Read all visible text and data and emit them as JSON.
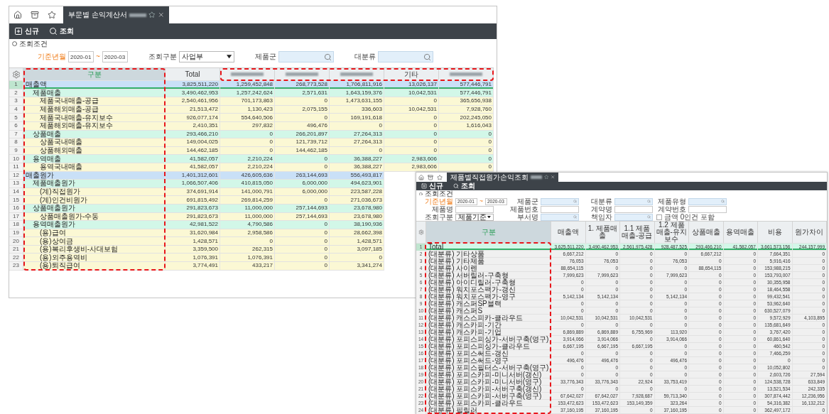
{
  "windows": [
    {
      "tab": {
        "title": "부문별 손익계산서",
        "title_redacted": true
      },
      "toolbar": [
        {
          "kind": "new",
          "label": "신규"
        },
        {
          "kind": "search",
          "label": "조회"
        }
      ],
      "filter_title": "조회조건",
      "filter_rows": [
        [
          {
            "kind": "period",
            "label": "기준년월",
            "required": true,
            "from": "2020-01",
            "separator": "~",
            "to": "2020-03"
          },
          {
            "kind": "select",
            "label": "조회구분",
            "required": false,
            "value": "사업부"
          },
          {
            "kind": "search",
            "label": "제품군",
            "required": false
          },
          {
            "kind": "search",
            "label": "대분류",
            "required": false
          }
        ]
      ],
      "grid": {
        "label_header": "구분",
        "columns": [
          {
            "label": "Total",
            "redacted": false
          },
          {
            "redacted": true
          },
          {
            "redacted": true
          },
          {
            "redacted": true
          },
          {
            "label": "기타",
            "redacted": false
          },
          {
            "redacted": true
          }
        ],
        "rows": [
          {
            "no": "1",
            "label": "매출액",
            "selected": true,
            "values": [
              "3,825,511,220",
              "1,259,452,848",
              "268,773,528",
              "1,706,811,916",
              "13,026,137",
              "577,446,791"
            ],
            "children": [
              {
                "no": "2",
                "label": "제품매출",
                "selected": false,
                "values": [
                  "3,490,462,953",
                  "1,257,242,624",
                  "2,571,631",
                  "1,643,159,376",
                  "10,042,531",
                  "577,446,791"
                ],
                "children": [
                  {
                    "no": "3",
                    "label": "제품국내매출-공급",
                    "selected": false,
                    "values": [
                      "2,540,461,956",
                      "701,173,863",
                      "0",
                      "1,473,631,155",
                      "0",
                      "365,656,938"
                    ]
                  },
                  {
                    "no": "4",
                    "label": "제품해외매출-공급",
                    "selected": false,
                    "values": [
                      "21,513,472",
                      "1,130,423",
                      "2,075,155",
                      "336,603",
                      "10,042,531",
                      "7,928,760"
                    ]
                  },
                  {
                    "no": "5",
                    "label": "제품국내매출-유지보수",
                    "selected": false,
                    "values": [
                      "926,077,174",
                      "554,640,506",
                      "0",
                      "169,191,618",
                      "0",
                      "202,245,050"
                    ]
                  },
                  {
                    "no": "6",
                    "label": "제품해외매출-유지보수",
                    "selected": false,
                    "values": [
                      "2,410,351",
                      "297,832",
                      "496,476",
                      "0",
                      "0",
                      "1,616,043"
                    ]
                  }
                ]
              },
              {
                "no": "7",
                "label": "상품매출",
                "selected": false,
                "values": [
                  "293,466,210",
                  "0",
                  "266,201,897",
                  "27,264,313",
                  "0",
                  "0"
                ],
                "children": [
                  {
                    "no": "8",
                    "label": "상품국내매출",
                    "selected": false,
                    "values": [
                      "149,004,025",
                      "0",
                      "121,739,712",
                      "27,264,313",
                      "0",
                      "0"
                    ]
                  },
                  {
                    "no": "9",
                    "label": "상품해외매출",
                    "selected": false,
                    "values": [
                      "144,462,185",
                      "0",
                      "144,462,185",
                      "0",
                      "0",
                      "0"
                    ]
                  }
                ]
              },
              {
                "no": "10",
                "label": "용역매출",
                "selected": false,
                "values": [
                  "41,582,057",
                  "2,210,224",
                  "0",
                  "36,388,227",
                  "2,983,606",
                  "0"
                ],
                "children": [
                  {
                    "no": "11",
                    "label": "용역국내매출",
                    "selected": false,
                    "values": [
                      "41,582,057",
                      "2,210,224",
                      "0",
                      "36,388,227",
                      "2,983,606",
                      "0"
                    ]
                  }
                ]
              }
            ]
          },
          {
            "no": "12",
            "label": "매출원가",
            "selected": false,
            "values": [
              "1,401,312,601",
              "426,605,636",
              "263,144,693",
              "556,493,817"
            ],
            "children": [
              {
                "no": "13",
                "label": "제품매출원가",
                "selected": false,
                "values": [
                  "1,066,507,406",
                  "410,815,050",
                  "6,000,000",
                  "494,623,901"
                ],
                "children": [
                  {
                    "no": "14",
                    "label": "(계)직접원가",
                    "selected": false,
                    "values": [
                      "374,691,914",
                      "141,000,791",
                      "6,000,000",
                      "223,587,228"
                    ]
                  },
                  {
                    "no": "15",
                    "label": "(계)인건비원가",
                    "selected": false,
                    "values": [
                      "691,815,492",
                      "269,814,259",
                      "0",
                      "271,036,673"
                    ]
                  }
                ]
              },
              {
                "no": "16",
                "label": "상품매출원가",
                "selected": false,
                "values": [
                  "291,823,673",
                  "11,000,000",
                  "257,144,693",
                  "23,678,980"
                ],
                "children": [
                  {
                    "no": "17",
                    "label": "상품매출원가-수동",
                    "selected": false,
                    "values": [
                      "291,823,673",
                      "11,000,000",
                      "257,144,693",
                      "23,678,980"
                    ]
                  }
                ]
              },
              {
                "no": "18",
                "label": "용역매출원가",
                "selected": false,
                "values": [
                  "42,981,522",
                  "4,790,586",
                  "0",
                  "38,190,936"
                ],
                "children": [
                  {
                    "no": "19",
                    "label": "(용)급여",
                    "selected": false,
                    "values": [
                      "31,620,984",
                      "2,958,586",
                      "0",
                      "28,662,398"
                    ]
                  },
                  {
                    "no": "20",
                    "label": "(용)상여금",
                    "selected": false,
                    "values": [
                      "1,428,571",
                      "0",
                      "0",
                      "1,428,571"
                    ]
                  },
                  {
                    "no": "21",
                    "label": "(용)복리후생비-사대보험",
                    "selected": false,
                    "values": [
                      "3,359,500",
                      "262,315",
                      "0",
                      "3,097,185"
                    ]
                  },
                  {
                    "no": "22",
                    "label": "(용)외주용역비",
                    "selected": false,
                    "values": [
                      "1,076,391",
                      "1,076,391",
                      "0",
                      "0"
                    ]
                  },
                  {
                    "no": "23",
                    "label": "(용)퇴직급여",
                    "selected": false,
                    "values": [
                      "3,774,491",
                      "433,217",
                      "0",
                      "3,341,274"
                    ]
                  }
                ]
              }
            ]
          }
        ]
      },
      "frames": [
        {
          "kind": "label-column"
        },
        {
          "kind": "header-range"
        }
      ]
    },
    {
      "tab": {
        "title": "제품별직접원가손익조회",
        "title_redacted": true
      },
      "toolbar": [
        {
          "kind": "new",
          "label": "신규"
        },
        {
          "kind": "search",
          "label": "조회"
        }
      ],
      "filter_title": "조회조건",
      "filter_rows": [
        [
          {
            "kind": "period",
            "label": "기준년월",
            "required": true,
            "from": "2020-01",
            "separator": "~",
            "to": "2020-03"
          },
          {
            "kind": "search",
            "label": "제품군",
            "required": false
          },
          {
            "kind": "search",
            "label": "대분류",
            "required": false
          },
          {
            "kind": "search",
            "label": "제품유형",
            "required": false
          }
        ],
        [
          {
            "kind": "text",
            "label": "제품명",
            "required": false
          },
          {
            "kind": "text",
            "label": "제품번호",
            "required": false
          },
          {
            "kind": "text",
            "label": "계약명",
            "required": false
          },
          {
            "kind": "text",
            "label": "계약번호",
            "required": false
          }
        ],
        [
          {
            "kind": "select",
            "label": "조회구분",
            "required": false,
            "value": "제품기준"
          },
          {
            "kind": "search",
            "label": "부서명",
            "required": false
          },
          {
            "kind": "search",
            "label": "책임자",
            "required": false
          },
          {
            "kind": "checkbox",
            "label": "금액 0인건 포함",
            "checked": false
          }
        ]
      ],
      "grid": {
        "label_header": "구분",
        "columns": [
          {
            "label": "매출액",
            "redacted": false
          },
          {
            "label": "1. 제품매출",
            "redacted": false
          },
          {
            "label": "1.1 제품매출-공급",
            "redacted": false
          },
          {
            "label": "1.2 제품매출-유지보수",
            "redacted": false
          },
          {
            "label": "상품매출",
            "redacted": false
          },
          {
            "label": "용역매출",
            "redacted": false
          },
          {
            "label": "비용",
            "redacted": false
          },
          {
            "label": "원가차이",
            "redacted": false
          }
        ],
        "rows": [
          {
            "no": "1",
            "label": "Total",
            "selected": true,
            "values": [
              "3,625,511,220",
              "3,490,462,953",
              "2,561,975,428",
              "928,487,525",
              "293,466,210",
              "41,582,057",
              "3,661,573,156",
              "244,157,999"
            ]
          },
          {
            "no": "2",
            "label": "(대분류) 기타상품",
            "selected": false,
            "values": [
              "6,667,212",
              "0",
              "0",
              "0",
              "6,667,212",
              "0",
              "7,664,351",
              "0"
            ]
          },
          {
            "no": "3",
            "label": "(대분류) 기타제품",
            "selected": false,
            "values": [
              "76,053",
              "76,053",
              "0",
              "76,053",
              "0",
              "0",
              "5,916,416",
              "0"
            ]
          },
          {
            "no": "4",
            "label": "(대분류) 사이렌",
            "selected": false,
            "values": [
              "88,654,115",
              "0",
              "0",
              "0",
              "88,654,115",
              "0",
              "153,988,215",
              "0"
            ]
          },
          {
            "no": "5",
            "label": "(대분류) 서버릴러-구축형",
            "selected": false,
            "values": [
              "7,999,623",
              "7,999,623",
              "0",
              "7,999,623",
              "0",
              "0",
              "153,793,007",
              "0"
            ]
          },
          {
            "no": "6",
            "label": "(대분류) 아이디릴러-구축형",
            "selected": false,
            "values": [
              "0",
              "0",
              "0",
              "0",
              "0",
              "0",
              "30,355,958",
              "0"
            ]
          },
          {
            "no": "7",
            "label": "(대분류) 워치포스팩가-갱신",
            "selected": false,
            "values": [
              "0",
              "0",
              "0",
              "0",
              "0",
              "0",
              "18,464,558",
              "0"
            ]
          },
          {
            "no": "8",
            "label": "(대분류) 워치포스팩가-영구",
            "selected": false,
            "values": [
              "5,142,134",
              "5,142,134",
              "0",
              "5,142,134",
              "0",
              "0",
              "99,432,541",
              "0"
            ]
          },
          {
            "no": "9",
            "label": "(대분류) 캐스퍼SP블랙",
            "selected": false,
            "values": [
              "0",
              "0",
              "0",
              "0",
              "0",
              "0",
              "53,962,640",
              "0"
            ]
          },
          {
            "no": "10",
            "label": "(대분류) 캐스퍼S",
            "selected": false,
            "values": [
              "0",
              "0",
              "0",
              "0",
              "0",
              "0",
              "630,527,079",
              "0"
            ]
          },
          {
            "no": "11",
            "label": "(대분류) 캐스스피카-클라우드",
            "selected": false,
            "values": [
              "10,042,531",
              "10,042,531",
              "10,042,531",
              "0",
              "0",
              "0",
              "9,572,929",
              "4,103,895"
            ]
          },
          {
            "no": "12",
            "label": "(대분류) 캐스카피-기간",
            "selected": false,
            "values": [
              "0",
              "0",
              "0",
              "0",
              "0",
              "0",
              "135,681,649",
              "0"
            ]
          },
          {
            "no": "13",
            "label": "(대분류) 캐스카피-기업",
            "selected": false,
            "values": [
              "6,869,889",
              "6,869,889",
              "6,755,969",
              "113,920",
              "0",
              "0",
              "3,767,420",
              "0"
            ]
          },
          {
            "no": "14",
            "label": "(대분류) 포피스피싱가-서버구축(영구)",
            "selected": false,
            "values": [
              "3,914,066",
              "3,914,066",
              "0",
              "3,914,066",
              "0",
              "0",
              "60,861,640",
              "0"
            ]
          },
          {
            "no": "15",
            "label": "(대분류) 포피스피싱가-클라우드",
            "selected": false,
            "values": [
              "6,667,195",
              "6,667,195",
              "6,667,195",
              "0",
              "0",
              "0",
              "460,542",
              "0"
            ]
          },
          {
            "no": "16",
            "label": "(대분류) 포피스써드-갱신",
            "selected": false,
            "values": [
              "0",
              "0",
              "0",
              "0",
              "0",
              "0",
              "7,466,259",
              "0"
            ]
          },
          {
            "no": "17",
            "label": "(대분류) 포피스써드-영구",
            "selected": false,
            "values": [
              "496,476",
              "496,476",
              "0",
              "496,476",
              "0",
              "0",
              "0",
              "0"
            ]
          },
          {
            "no": "18",
            "label": "(대분류) 포피스필터스-서버구축(영구)",
            "selected": false,
            "values": [
              "0",
              "0",
              "0",
              "0",
              "0",
              "0",
              "10,052,802",
              "0"
            ]
          },
          {
            "no": "19",
            "label": "(대분류) 포피스카피-미니서버(갱신)",
            "selected": false,
            "values": [
              "0",
              "0",
              "0",
              "0",
              "0",
              "0",
              "2,603,726",
              "27,594"
            ]
          },
          {
            "no": "20",
            "label": "(대분류) 포피스카피-미니서버(영구)",
            "selected": false,
            "values": [
              "33,776,343",
              "33,776,343",
              "22,924",
              "33,753,419",
              "0",
              "0",
              "124,538,728",
              "633,849"
            ]
          },
          {
            "no": "21",
            "label": "(대분류) 포피스카피-서버구축(갱신)",
            "selected": false,
            "values": [
              "0",
              "0",
              "0",
              "0",
              "0",
              "0",
              "13,521,534",
              "242,335"
            ]
          },
          {
            "no": "22",
            "label": "(대분류) 포피스카피-서버구축(영구)",
            "selected": false,
            "values": [
              "67,642,027",
              "67,642,027",
              "7,928,687",
              "59,713,340",
              "0",
              "0",
              "307,874,442",
              "12,236,956"
            ]
          },
          {
            "no": "23",
            "label": "(대분류) 포피스카피-클라우드",
            "selected": false,
            "values": [
              "153,472,623",
              "153,472,623",
              "153,149,359",
              "323,264",
              "0",
              "0",
              "54,316,382",
              "16,132,212"
            ]
          },
          {
            "no": "24",
            "label": "(대분류) 필릴러",
            "selected": false,
            "values": [
              "37,160,195",
              "37,160,195",
              "0",
              "37,160,195",
              "0",
              "0",
              "362,497,172",
              "0"
            ]
          }
        ]
      },
      "frames": [
        {
          "kind": "label-cells"
        }
      ]
    }
  ]
}
